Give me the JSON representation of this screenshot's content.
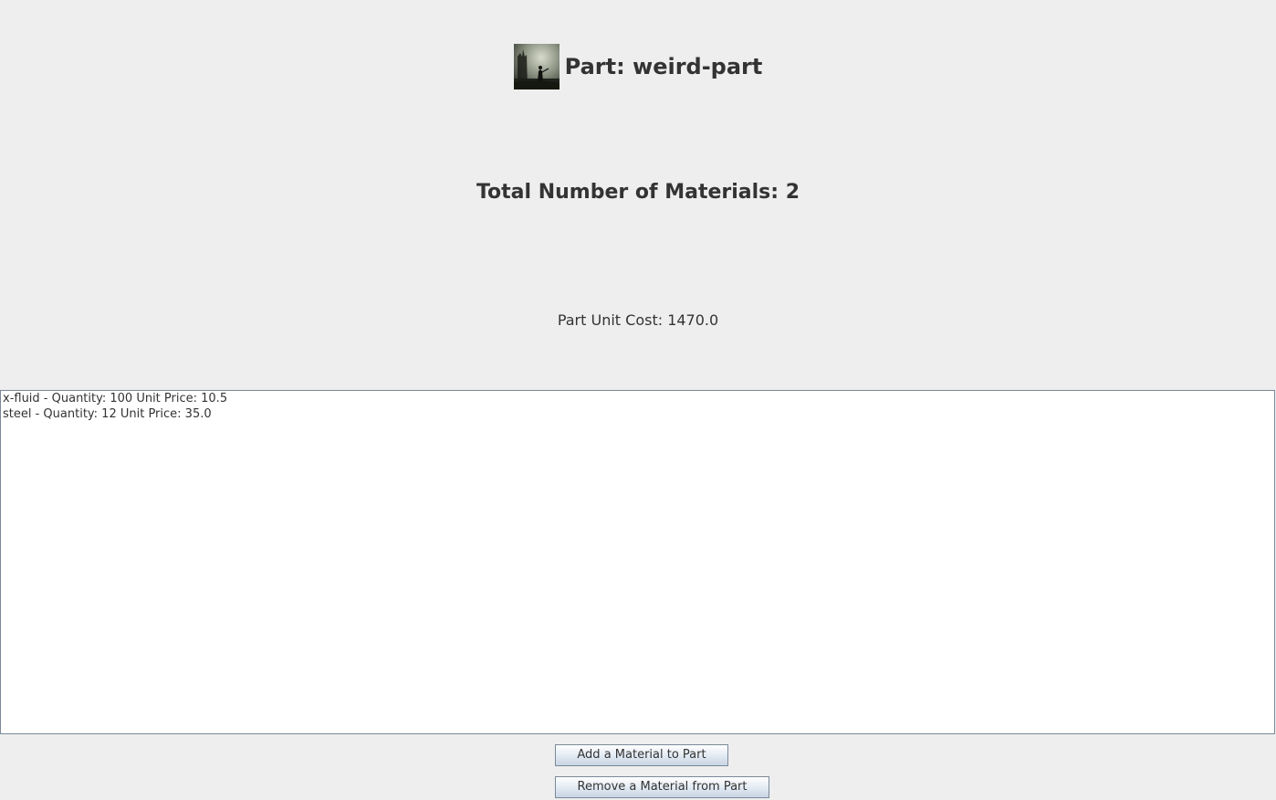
{
  "header": {
    "title": "Part: weird-part",
    "image": "part-thumbnail-icon"
  },
  "summary": {
    "total_materials": "Total Number of Materials: 2",
    "unit_cost": "Part Unit Cost: 1470.0"
  },
  "materials": [
    "x-fluid - Quantity: 100 Unit Price: 10.5",
    "steel - Quantity: 12 Unit Price: 35.0"
  ],
  "buttons": {
    "add_label": "Add a Material to Part",
    "remove_label": "Remove a Material from Part"
  },
  "colors": {
    "background": "#eeeeee",
    "text": "#333333",
    "list_background": "#ffffff",
    "border": "#7a8a99"
  }
}
